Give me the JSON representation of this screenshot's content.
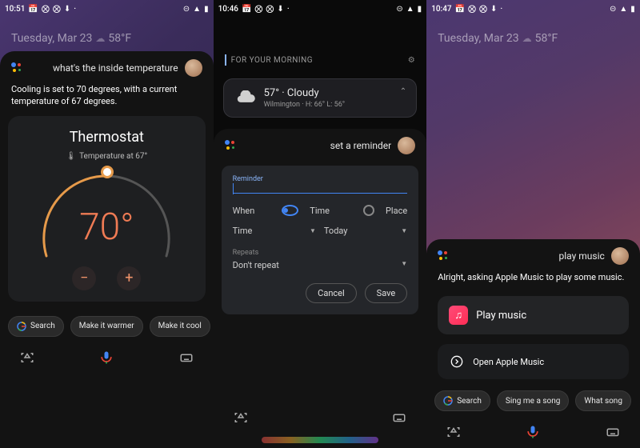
{
  "screen1": {
    "time": "10:51",
    "date": "Tuesday, Mar 23",
    "temp_out": "58°F",
    "query": "what's the inside temperature",
    "response": "Cooling is set to 70 degrees, with a current temperature of 67 degrees.",
    "thermostat": {
      "title": "Thermostat",
      "current_label": "Temperature at 67°",
      "set_temp": "70°"
    },
    "chips": [
      "Search",
      "Make it warmer",
      "Make it cool"
    ]
  },
  "screen2": {
    "time": "10:46",
    "morning_label": "FOR YOUR MORNING",
    "weather": {
      "main": "57° · Cloudy",
      "sub": "Wilmington · H: 66° L: 56°"
    },
    "query": "set a reminder",
    "reminder": {
      "label": "Reminder",
      "when_label": "When",
      "opt_time": "Time",
      "opt_place": "Place",
      "time_sel": "Time",
      "date_sel": "Today",
      "repeats_label": "Repeats",
      "repeats_value": "Don't repeat",
      "cancel": "Cancel",
      "save": "Save"
    }
  },
  "screen3": {
    "time": "10:47",
    "date": "Tuesday, Mar 23",
    "temp_out": "58°F",
    "query": "play music",
    "response": "Alright, asking Apple Music to play some music.",
    "action_primary": "Play music",
    "action_secondary": "Open Apple Music",
    "chips": [
      "Search",
      "Sing me a song",
      "What song"
    ]
  }
}
